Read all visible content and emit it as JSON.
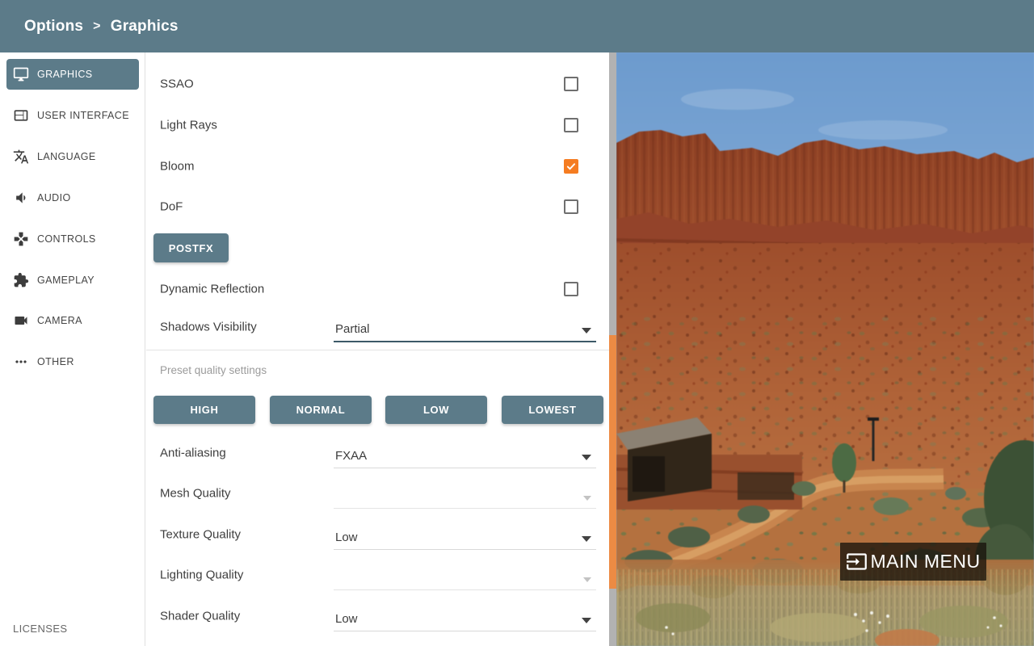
{
  "colors": {
    "accent_orange": "#f57c21",
    "teal": "#5c7b89",
    "scrollbar_thumb": "#ec8b44",
    "active_underline": "#3d5a68"
  },
  "header": {
    "path": [
      "Options",
      "Graphics"
    ],
    "separator": ">"
  },
  "sidebar": {
    "items": [
      {
        "label": "GRAPHICS",
        "icon": "monitor-icon",
        "selected": true
      },
      {
        "label": "USER INTERFACE",
        "icon": "window-icon",
        "selected": false
      },
      {
        "label": "LANGUAGE",
        "icon": "translate-icon",
        "selected": false
      },
      {
        "label": "AUDIO",
        "icon": "speaker-icon",
        "selected": false
      },
      {
        "label": "CONTROLS",
        "icon": "dpad-icon",
        "selected": false
      },
      {
        "label": "GAMEPLAY",
        "icon": "puzzle-icon",
        "selected": false
      },
      {
        "label": "CAMERA",
        "icon": "videocam-icon",
        "selected": false
      },
      {
        "label": "OTHER",
        "icon": "dots-icon",
        "selected": false
      }
    ],
    "footer_label": "LICENSES"
  },
  "panel": {
    "toggles": [
      {
        "label": "SSAO",
        "checked": false
      },
      {
        "label": "Light Rays",
        "checked": false
      },
      {
        "label": "Bloom",
        "checked": true
      },
      {
        "label": "DoF",
        "checked": false
      }
    ],
    "postfx_button_label": "POSTFX",
    "extra_toggles": [
      {
        "label": "Dynamic Reflection",
        "checked": false
      }
    ],
    "shadows_dropdown": {
      "label": "Shadows Visibility",
      "value": "Partial",
      "state": "active"
    },
    "preset": {
      "caption": "Preset quality settings",
      "buttons": [
        "HIGH",
        "NORMAL",
        "LOW",
        "LOWEST"
      ]
    },
    "quality_dropdowns": [
      {
        "label": "Anti-aliasing",
        "value": "FXAA",
        "state": "normal"
      },
      {
        "label": "Mesh Quality",
        "value": "",
        "state": "disabled"
      },
      {
        "label": "Texture Quality",
        "value": "Low",
        "state": "normal"
      },
      {
        "label": "Lighting Quality",
        "value": "",
        "state": "disabled"
      },
      {
        "label": "Shader Quality",
        "value": "Low",
        "state": "normal"
      }
    ]
  },
  "scene": {
    "main_menu_label": "MAIN MENU",
    "main_menu_icon": "enter-box-icon"
  }
}
